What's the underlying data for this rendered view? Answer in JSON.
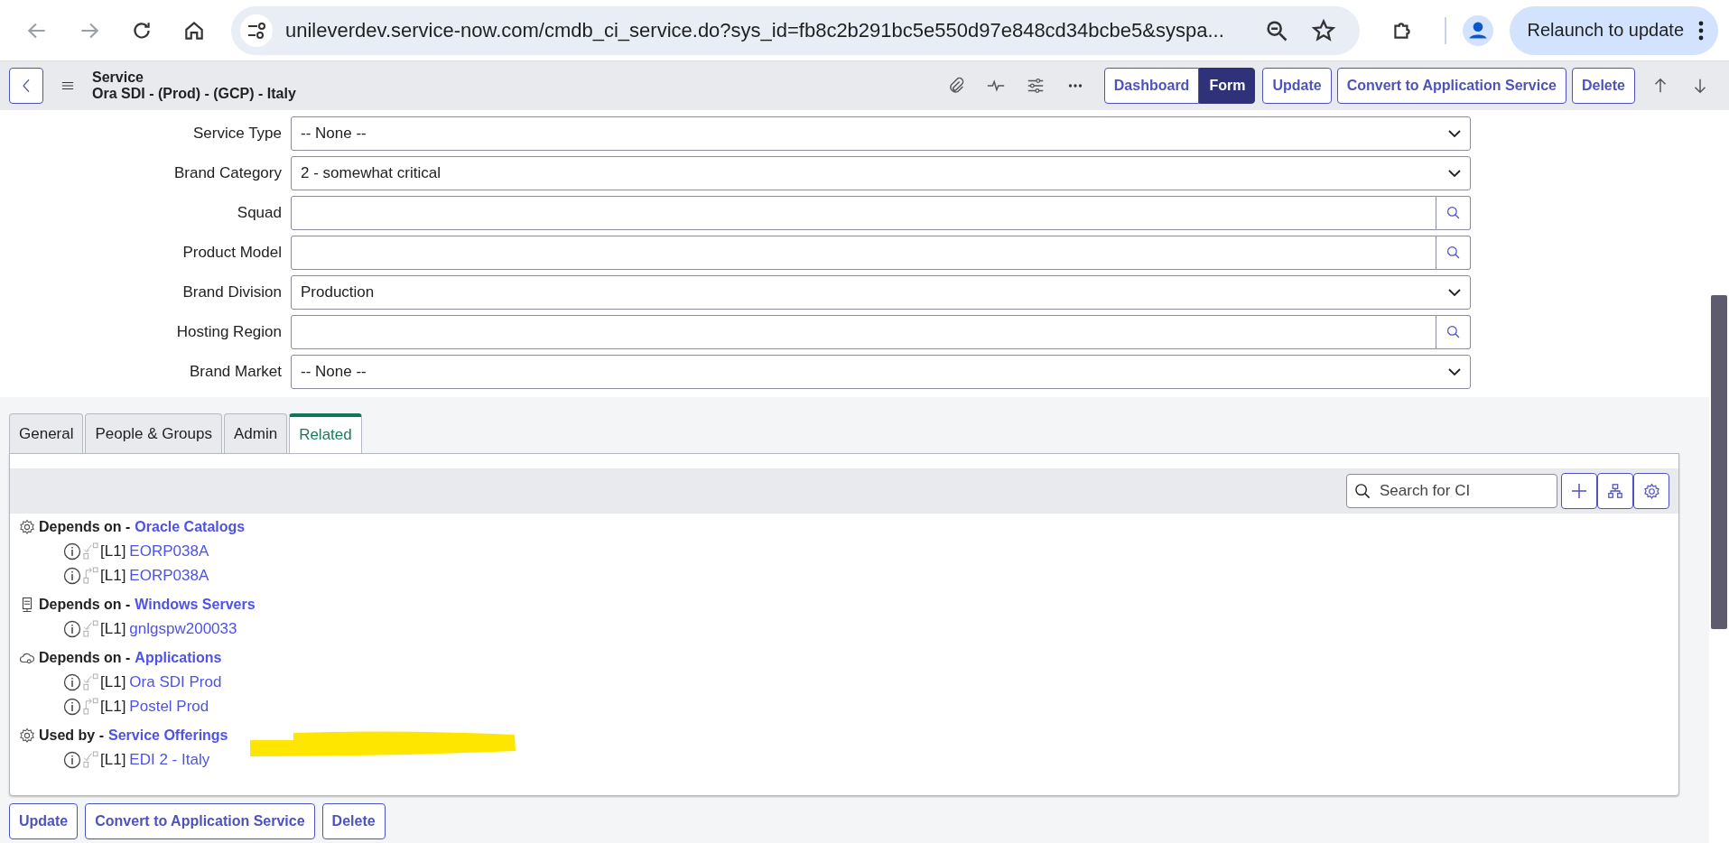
{
  "browser": {
    "url": "unileverdev.service-now.com/cmdb_ci_service.do?sys_id=fb8c2b291bc5e550d97e848cd34bcbe5&syspa...",
    "relaunch_label": "Relaunch to update"
  },
  "header": {
    "title": "Service",
    "subtitle": "Ora SDI - (Prod) - (GCP) - Italy",
    "view_toggle": [
      {
        "label": "Dashboard",
        "selected": false
      },
      {
        "label": "Form",
        "selected": true
      }
    ],
    "buttons": [
      "Update",
      "Convert to Application Service",
      "Delete"
    ]
  },
  "form": {
    "fields": [
      {
        "label": "Service Type",
        "kind": "select",
        "value": "-- None --"
      },
      {
        "label": "Brand Category",
        "kind": "select",
        "value": "2 - somewhat critical"
      },
      {
        "label": "Squad",
        "kind": "reference"
      },
      {
        "label": "Product Model",
        "kind": "reference"
      },
      {
        "label": "Brand Division",
        "kind": "select",
        "value": "Production"
      },
      {
        "label": "Hosting Region",
        "kind": "reference"
      },
      {
        "label": "Brand Market",
        "kind": "select",
        "value": "-- None --"
      }
    ]
  },
  "tabs": [
    {
      "label": "General",
      "selected": false
    },
    {
      "label": "People & Groups",
      "selected": false
    },
    {
      "label": "Admin",
      "selected": false
    },
    {
      "label": "Related",
      "selected": true
    }
  ],
  "related": {
    "search": {
      "placeholder": "Search for CI"
    },
    "groups": [
      {
        "kind": "gear",
        "relation": "Depends on -",
        "target": "Oracle Catalogs",
        "items": [
          {
            "kind": "down",
            "tier": "[L1]",
            "name": "EORP038A"
          },
          {
            "kind": "up",
            "tier": "[L1]",
            "name": "EORP038A"
          }
        ]
      },
      {
        "kind": "server",
        "relation": "Depends on -",
        "target": "Windows Servers",
        "items": [
          {
            "kind": "down",
            "tier": "[L1]",
            "name": "gnlgspw200033"
          }
        ]
      },
      {
        "kind": "cloud",
        "relation": "Depends on -",
        "target": "Applications",
        "items": [
          {
            "kind": "down",
            "tier": "[L1]",
            "name": "Ora SDI Prod"
          },
          {
            "kind": "up",
            "tier": "[L1]",
            "name": "Postel Prod"
          }
        ]
      },
      {
        "kind": "gear",
        "relation": "Used by -",
        "target": "Service Offerings",
        "highlighted": true,
        "items": [
          {
            "kind": "down",
            "tier": "[L1]",
            "name": "EDI 2 - Italy"
          }
        ]
      }
    ]
  },
  "bottom_buttons": [
    "Update",
    "Convert to Application Service",
    "Delete"
  ]
}
